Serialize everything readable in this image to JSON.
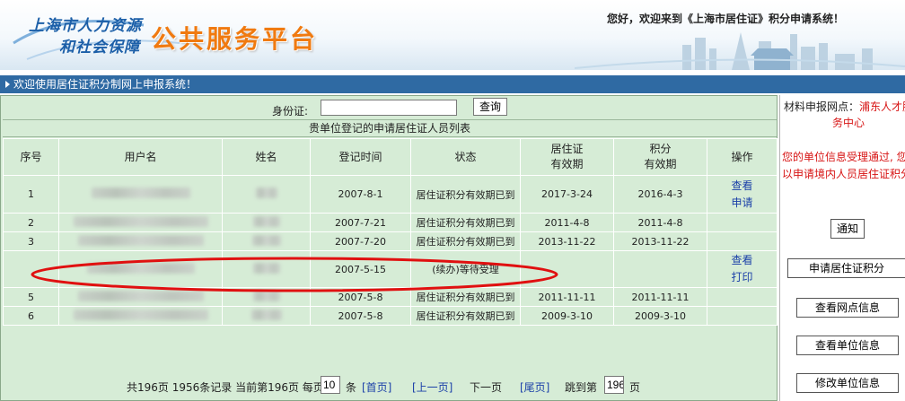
{
  "header": {
    "logo_line1": "上海市人力资源",
    "logo_line2": "和社会保障",
    "logo_big": "公共服务平台",
    "welcome": "您好，欢迎来到《上海市居住证》积分申请系统！"
  },
  "banner": {
    "text": "欢迎使用居住证积分制网上申报系统！"
  },
  "search": {
    "label": "身份证:",
    "value": "",
    "button": "查询"
  },
  "table": {
    "title": "贵单位登记的申请居住证人员列表",
    "headers": [
      "序号",
      "用户名",
      "姓名",
      "登记时间",
      "状态",
      "居住证\n有效期",
      "积分\n有效期",
      "操作"
    ],
    "rows": [
      {
        "no": "1",
        "date": "2007-8-1",
        "status": "居住证积分有效期已到",
        "permit": "2017-3-24",
        "score": "2016-4-3",
        "actions": [
          "查看",
          "申请"
        ]
      },
      {
        "no": "2",
        "date": "2007-7-21",
        "status": "居住证积分有效期已到",
        "permit": "2011-4-8",
        "score": "2011-4-8",
        "actions": []
      },
      {
        "no": "3",
        "date": "2007-7-20",
        "status": "居住证积分有效期已到",
        "permit": "2013-11-22",
        "score": "2013-11-22",
        "actions": []
      },
      {
        "no": "",
        "date": "2007-5-15",
        "status": "(续办)等待受理",
        "permit": "",
        "score": "",
        "actions": [
          "查看",
          "打印"
        ]
      },
      {
        "no": "5",
        "date": "2007-5-8",
        "status": "居住证积分有效期已到",
        "permit": "2011-11-11",
        "score": "2011-11-11",
        "actions": []
      },
      {
        "no": "6",
        "date": "2007-5-8",
        "status": "居住证积分有效期已到",
        "permit": "2009-3-10",
        "score": "2009-3-10",
        "actions": []
      }
    ]
  },
  "pager": {
    "summary": "共196页 1956条记录 当前第196页 每页",
    "per_page": "10",
    "tiao": "条",
    "first": "[首页]",
    "prev": "[上一页]",
    "next": "下一页",
    "last": "[尾页]",
    "jump_label": "跳到第",
    "jump_value": "196",
    "page_unit": "页"
  },
  "right": {
    "site_label": "材料申报网点：",
    "site_name": "浦东人才服",
    "site_center": "务中心",
    "msg_line1": "您的单位信息受理通过, 您",
    "msg_line2": "以申请境内人员居住证积分",
    "btn_notice": "通知",
    "btn_apply": "申请居住证积分",
    "btn_view_site": "查看网点信息",
    "btn_view_unit": "查看单位信息",
    "btn_edit_unit": "修改单位信息"
  },
  "colors": {
    "panel_green": "#d6ecd6",
    "banner_blue": "#2f6aa3",
    "link_blue": "#1a3fa8",
    "alert_red": "#d71414",
    "annotation_red": "#e01010"
  }
}
